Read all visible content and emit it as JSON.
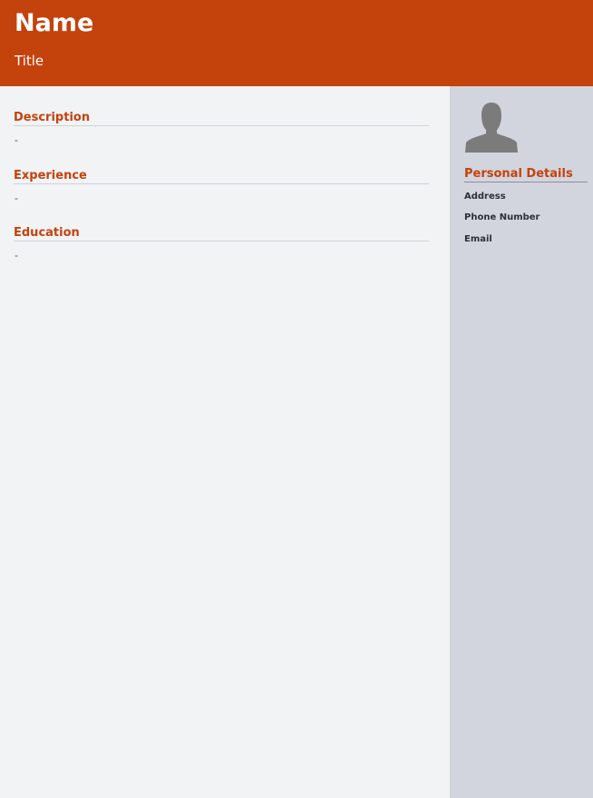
{
  "header": {
    "name": "Name",
    "title": "Title"
  },
  "sections": [
    {
      "heading": "Description",
      "content": "-"
    },
    {
      "heading": "Experience",
      "content": "-"
    },
    {
      "heading": "Education",
      "content": "-"
    }
  ],
  "sidebar": {
    "avatar_icon": "person-silhouette-icon",
    "heading": "Personal Details",
    "fields": [
      "Address",
      "Phone Number",
      "Email"
    ]
  },
  "colors": {
    "accent": "#c4420c",
    "main_background": "#f2f3f5",
    "sidebar_background": "#d2d5de",
    "avatar": "#7b7b7b"
  }
}
